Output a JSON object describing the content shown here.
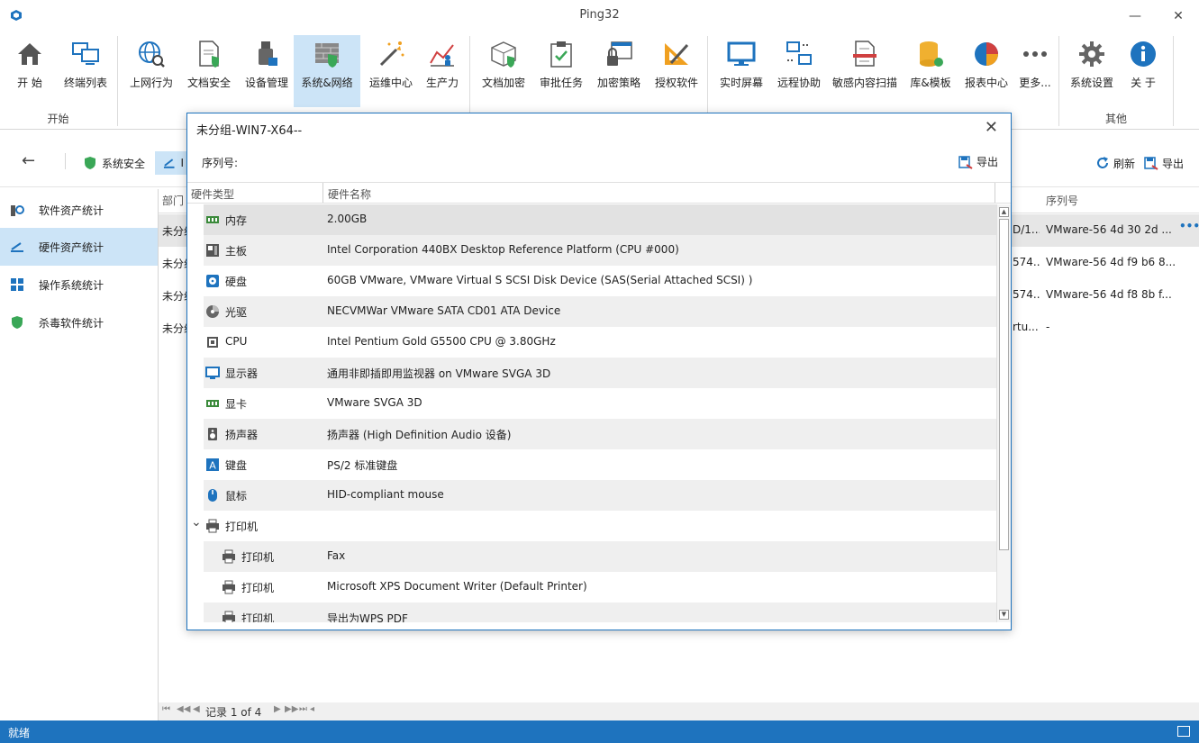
{
  "window": {
    "title": "Ping32"
  },
  "ribbon": {
    "groups": [
      {
        "label": "开始",
        "items": [
          "开 始",
          "终端列表"
        ]
      },
      {
        "label": "",
        "items": [
          "上网行为",
          "文档安全",
          "设备管理",
          "系统&网络",
          "运维中心",
          "生产力"
        ]
      },
      {
        "label": "",
        "items": [
          "文档加密",
          "审批任务",
          "加密策略",
          "授权软件"
        ]
      },
      {
        "label": "",
        "items": [
          "实时屏幕",
          "远程协助",
          "敏感内容扫描",
          "库&模板",
          "报表中心",
          "更多..."
        ]
      },
      {
        "label": "其他",
        "items": [
          "系统设置",
          "关 于"
        ]
      }
    ],
    "active": "系统&网络"
  },
  "subbar": {
    "tabs": [
      "系统安全",
      "I"
    ],
    "refresh": "刷新",
    "export": "导出"
  },
  "leftnav": {
    "items": [
      "软件资产统计",
      "硬件资产统计",
      "操作系统统计",
      "杀毒软件统计"
    ],
    "selected": "硬件资产统计"
  },
  "grid": {
    "headers": [
      "部门",
      "序列号"
    ],
    "rows": [
      {
        "dept": "未分组",
        "mid": "D/1...",
        "serial": "VMware-56 4d 30 2d ..."
      },
      {
        "dept": "未分组",
        "mid": "574...",
        "serial": "VMware-56 4d f9 b6 8..."
      },
      {
        "dept": "未分组",
        "mid": "574...",
        "serial": "VMware-56 4d f8 8b f..."
      },
      {
        "dept": "未分组",
        "mid": "rtu...",
        "serial": "-"
      }
    ]
  },
  "pager": {
    "text": "记录 1 of 4"
  },
  "status": {
    "text": "就绪"
  },
  "dialog": {
    "title": "未分组-WIN7-X64--",
    "serial_label": "序列号:",
    "export": "导出",
    "columns": [
      "硬件类型",
      "硬件名称"
    ],
    "rows": [
      {
        "icon": "memory-icon",
        "type": "内存",
        "name": "2.00GB"
      },
      {
        "icon": "motherboard-icon",
        "type": "主板",
        "name": "Intel Corporation 440BX Desktop Reference Platform (CPU #000)"
      },
      {
        "icon": "disk-icon",
        "type": "硬盘",
        "name": "60GB VMware, VMware Virtual S SCSI Disk Device (SAS(Serial Attached SCSI) )"
      },
      {
        "icon": "cdrom-icon",
        "type": "光驱",
        "name": "NECVMWar VMware SATA CD01 ATA Device"
      },
      {
        "icon": "cpu-icon",
        "type": "CPU",
        "name": "Intel Pentium Gold G5500 CPU @ 3.80GHz"
      },
      {
        "icon": "monitor-icon",
        "type": "显示器",
        "name": "通用非即插即用监视器 on VMware SVGA 3D"
      },
      {
        "icon": "graphics-card-icon",
        "type": "显卡",
        "name": "VMware SVGA 3D"
      },
      {
        "icon": "speaker-icon",
        "type": "扬声器",
        "name": "扬声器 (High Definition Audio 设备)"
      },
      {
        "icon": "keyboard-icon",
        "type": "键盘",
        "name": "PS/2 标准键盘"
      },
      {
        "icon": "mouse-icon",
        "type": "鼠标",
        "name": "HID-compliant mouse"
      },
      {
        "icon": "printer-icon",
        "type": "打印机",
        "name": ""
      },
      {
        "icon": "printer-icon",
        "type": "打印机",
        "name": "Fax"
      },
      {
        "icon": "printer-icon",
        "type": "打印机",
        "name": "Microsoft XPS Document Writer (Default Printer)"
      },
      {
        "icon": "printer-icon",
        "type": "打印机",
        "name": "导出为WPS PDF"
      }
    ]
  },
  "colors": {
    "accent": "#1e73be",
    "selection": "#cce4f7"
  }
}
